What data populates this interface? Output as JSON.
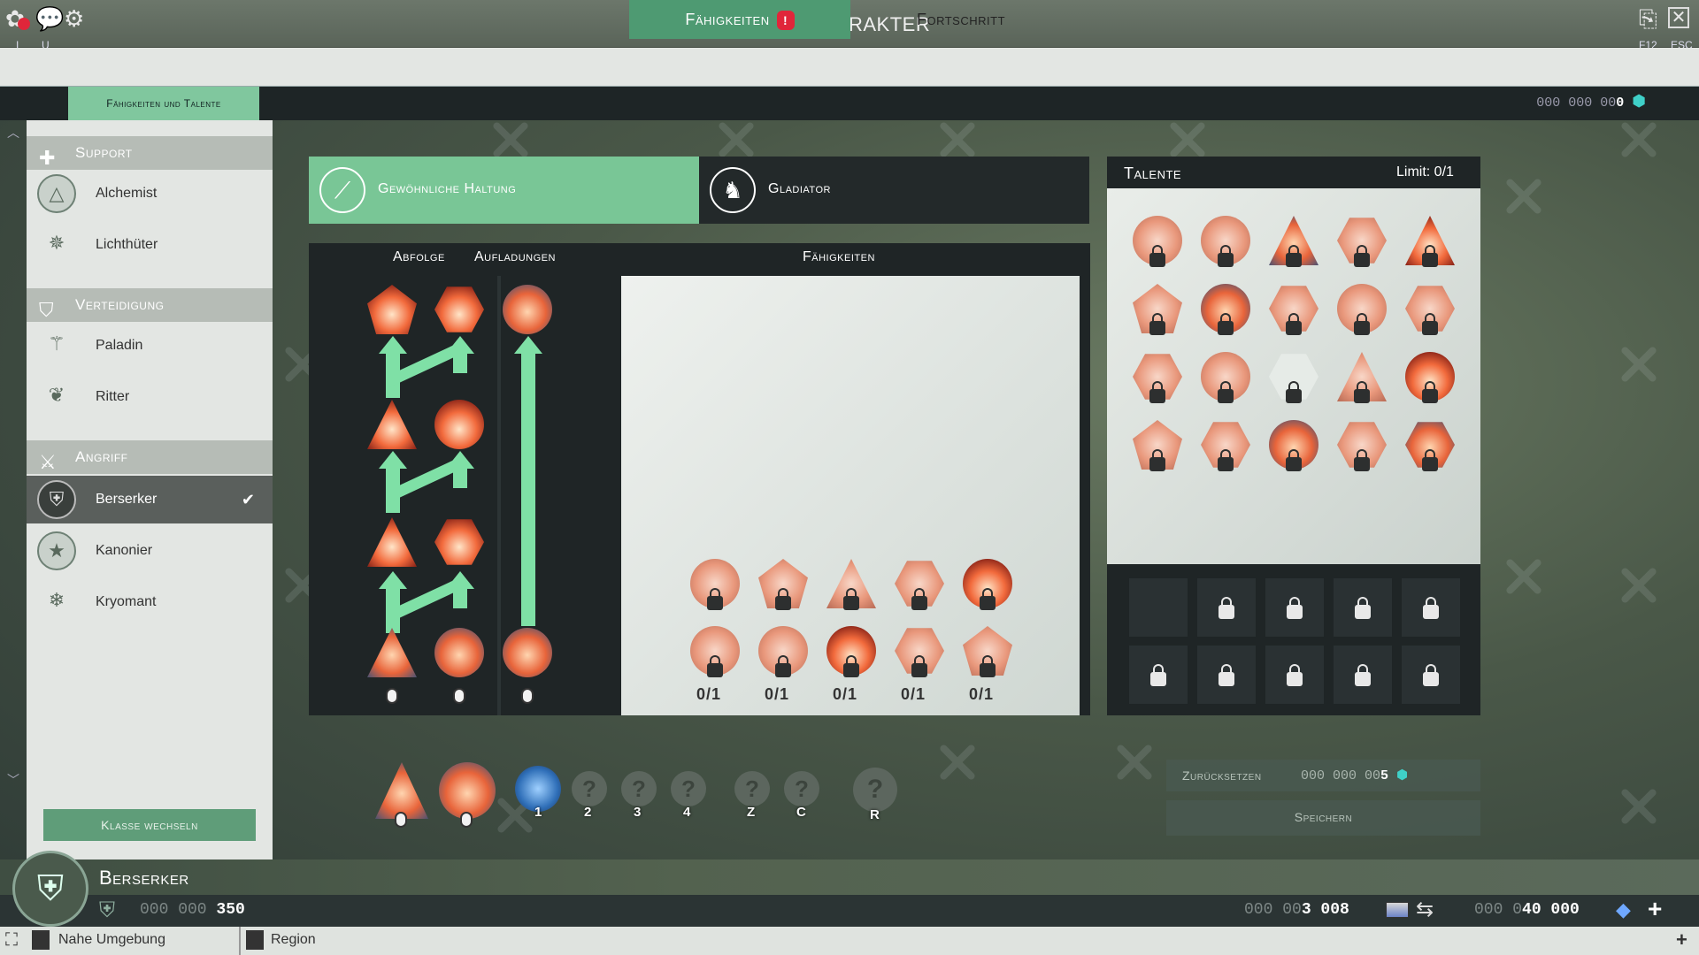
{
  "header": {
    "title": "Charakter",
    "left_keys": [
      "I",
      "U"
    ],
    "right_keys": [
      "F12",
      "ESC"
    ]
  },
  "tabs": [
    {
      "label": "Fähigkeiten",
      "active": true,
      "alert": "!"
    },
    {
      "label": "Fortschritt",
      "active": false
    }
  ],
  "subtab": "Fähigkeiten und Talente",
  "top_currency": {
    "dim": "000 000 00",
    "value": "0"
  },
  "sidebar": {
    "categories": [
      {
        "label": "Support",
        "classes": [
          "Alchemist",
          "Lichthüter"
        ]
      },
      {
        "label": "Verteidigung",
        "classes": [
          "Paladin",
          "Ritter"
        ]
      },
      {
        "label": "Angriff",
        "classes": [
          "Berserker",
          "Kanonier",
          "Kryomant"
        ]
      }
    ],
    "selected_class": "Berserker",
    "switch_button": "Klasse wechseln"
  },
  "stances": [
    {
      "label": "Gewöhnliche Haltung",
      "active": true
    },
    {
      "label": "Gladiator",
      "active": false
    }
  ],
  "combo": {
    "col_sequence": "Abfolge",
    "col_charges": "Aufladungen",
    "col_abilities": "Fähigkeiten",
    "counts": [
      "0/1",
      "0/1",
      "0/1",
      "0/1",
      "0/1"
    ]
  },
  "talents": {
    "title": "Talente",
    "limit": "Limit: 0/1"
  },
  "hotbar": {
    "keys": [
      "1",
      "2",
      "3",
      "4",
      "Z",
      "C",
      "R"
    ],
    "unknown": "?"
  },
  "reset": {
    "label": "Zurücksetzen",
    "cost_dim": "000 000 00",
    "cost_value": "5"
  },
  "save": {
    "label": "Speichern"
  },
  "character": {
    "name": "Berserker",
    "xp_dim": "000 000 ",
    "xp_value": "350"
  },
  "money": {
    "gold_dim": "000 00",
    "gold_value": "3 008",
    "gems_dim": "000 0",
    "gems_value": "40 000"
  },
  "location": {
    "nearby": "Nahe Umgebung",
    "region": "Region"
  },
  "colors": {
    "accent": "#4e9a72",
    "stance_active": "#79c696",
    "alert": "#e0263a"
  }
}
